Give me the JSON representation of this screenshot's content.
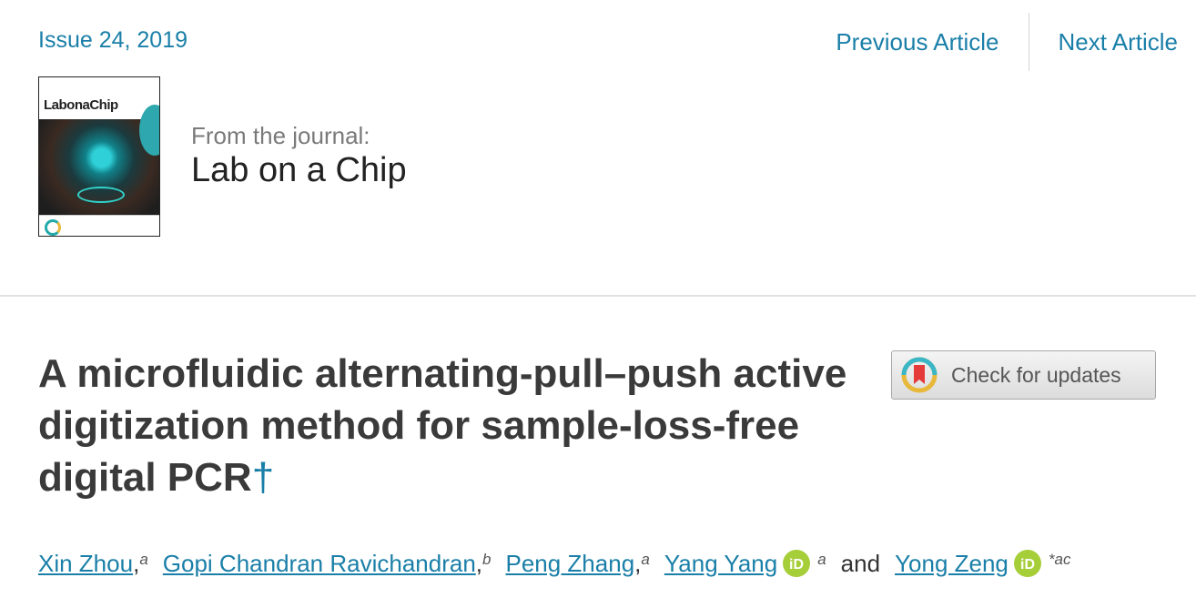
{
  "issue_label": "Issue 24, 2019",
  "nav": {
    "previous": "Previous Article",
    "next": "Next Article"
  },
  "journal": {
    "from_label": "From the journal:",
    "name": "Lab on a Chip",
    "cover_title": "LabonaChip"
  },
  "article": {
    "title": "A microfluidic alternating-pull–push active digitization method for sample-loss-free digital PCR",
    "title_footnote": "†"
  },
  "updates_button": {
    "label": "Check for updates"
  },
  "authors": [
    {
      "name": "Xin Zhou",
      "affil": "a",
      "orcid": false
    },
    {
      "name": "Gopi Chandran Ravichandran",
      "affil": "b",
      "orcid": false
    },
    {
      "name": "Peng Zhang",
      "affil": "a",
      "orcid": false
    },
    {
      "name": "Yang Yang",
      "affil": "a",
      "orcid": true
    },
    {
      "name": "Yong Zeng",
      "affil": "*ac",
      "orcid": true
    }
  ],
  "author_conjunction": "and",
  "colors": {
    "link": "#1a7fa8",
    "title": "#3a3a3a",
    "orcid": "#a6ce39"
  }
}
